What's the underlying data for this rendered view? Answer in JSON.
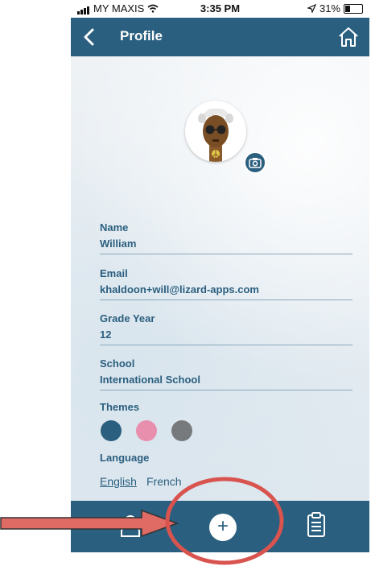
{
  "status_bar": {
    "carrier": "MY MAXIS",
    "time": "3:35 PM",
    "battery": "31%",
    "battery_level": 0.31
  },
  "header": {
    "title": "Profile",
    "back_icon": "chevron-left-icon",
    "home_icon": "home-icon"
  },
  "profile": {
    "avatar_icon": "avatar-character",
    "camera_icon": "camera-icon",
    "fields": [
      {
        "label": "Name",
        "value": "William"
      },
      {
        "label": "Email",
        "value": "khaldoon+will@lizard-apps.com"
      },
      {
        "label": "Grade Year",
        "value": "12"
      },
      {
        "label": "School",
        "value": "International School"
      }
    ],
    "themes": {
      "label": "Themes",
      "colors": [
        "#2b5f7f",
        "#e98fae",
        "#777a7d"
      ]
    },
    "language": {
      "label": "Language",
      "options": [
        "English",
        "French"
      ],
      "selected": "English"
    }
  },
  "tab_bar": {
    "items": [
      "profile-icon",
      "add-icon",
      "clipboard-icon"
    ],
    "add_symbol": "+"
  },
  "annotations": {
    "arrow_color": "#e06a64",
    "ring_color": "#d9534f"
  }
}
